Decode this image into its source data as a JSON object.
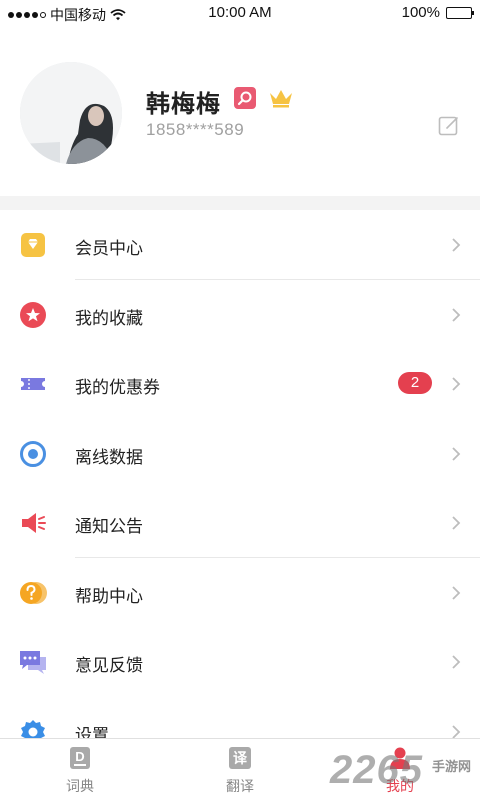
{
  "status_bar": {
    "carrier": "中国移动",
    "time": "10:00 AM",
    "battery": "100%"
  },
  "profile": {
    "name": "韩梅梅",
    "phone": "1858****589"
  },
  "menu": [
    {
      "label": "会员中心",
      "icon": "diamond-icon",
      "color": "#f6c343"
    },
    {
      "label": "我的收藏",
      "icon": "star-icon",
      "color": "#ea4a56"
    },
    {
      "label": "我的优惠券",
      "icon": "ticket-icon",
      "color": "#7a79e0",
      "badge": "2"
    },
    {
      "label": "离线数据",
      "icon": "download-icon",
      "color": "#4a90e2"
    },
    {
      "label": "通知公告",
      "icon": "megaphone-icon",
      "color": "#ea4a56"
    },
    {
      "label": "帮助中心",
      "icon": "help-icon",
      "color": "#f5a623"
    },
    {
      "label": "意见反馈",
      "icon": "feedback-icon",
      "color": "#7a79e0"
    },
    {
      "label": "设置",
      "icon": "settings-icon",
      "color": "#3a8ee6"
    }
  ],
  "tabs": [
    {
      "label": "词典",
      "icon": "dictionary-icon",
      "glyph": "D"
    },
    {
      "label": "翻译",
      "icon": "translate-icon",
      "glyph": "译"
    },
    {
      "label": "我的",
      "icon": "profile-icon",
      "active": true
    }
  ],
  "watermark": {
    "main": "2265",
    "sub": "手游网"
  },
  "colors": {
    "accent": "#e4404f",
    "background": "#ffffff",
    "section_gap": "#f3f3f3"
  }
}
